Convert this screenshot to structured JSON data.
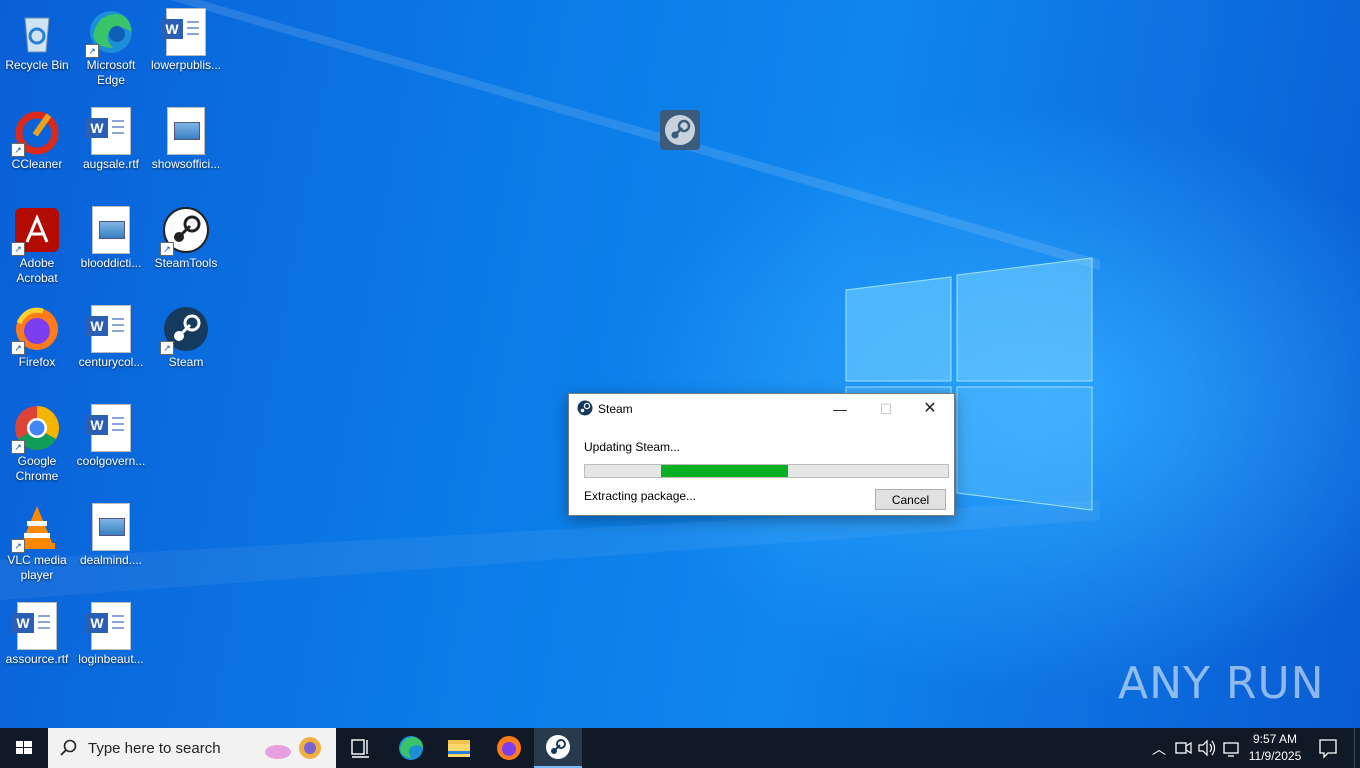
{
  "desktop": {
    "icons": [
      {
        "label": "Recycle Bin"
      },
      {
        "label": "Microsoft Edge"
      },
      {
        "label": "lowerpublis..."
      },
      {
        "label": "CCleaner"
      },
      {
        "label": "augsale.rtf"
      },
      {
        "label": "showsoffici..."
      },
      {
        "label": "Adobe Acrobat"
      },
      {
        "label": "blooddicti..."
      },
      {
        "label": "SteamTools"
      },
      {
        "label": "Firefox"
      },
      {
        "label": "centurycol..."
      },
      {
        "label": "Steam"
      },
      {
        "label": "Google Chrome"
      },
      {
        "label": "coolgovern..."
      },
      {
        "label": "VLC media player"
      },
      {
        "label": "dealmind...."
      },
      {
        "label": "assource.rtf"
      },
      {
        "label": "loginbeaut..."
      }
    ]
  },
  "dialog": {
    "title": "Steam",
    "message": "Updating Steam...",
    "status": "Extracting package...",
    "cancel_label": "Cancel",
    "progress": 0.35,
    "accent": "#06b025"
  },
  "watermark": {
    "text": "ANY RUN"
  },
  "taskbar": {
    "search_placeholder": "Type here to search",
    "time": "9:57 AM",
    "date": "11/9/2025",
    "pinned": [
      "task-view-icon",
      "edge-icon",
      "file-explorer-icon",
      "firefox-icon",
      "steam-icon"
    ]
  }
}
